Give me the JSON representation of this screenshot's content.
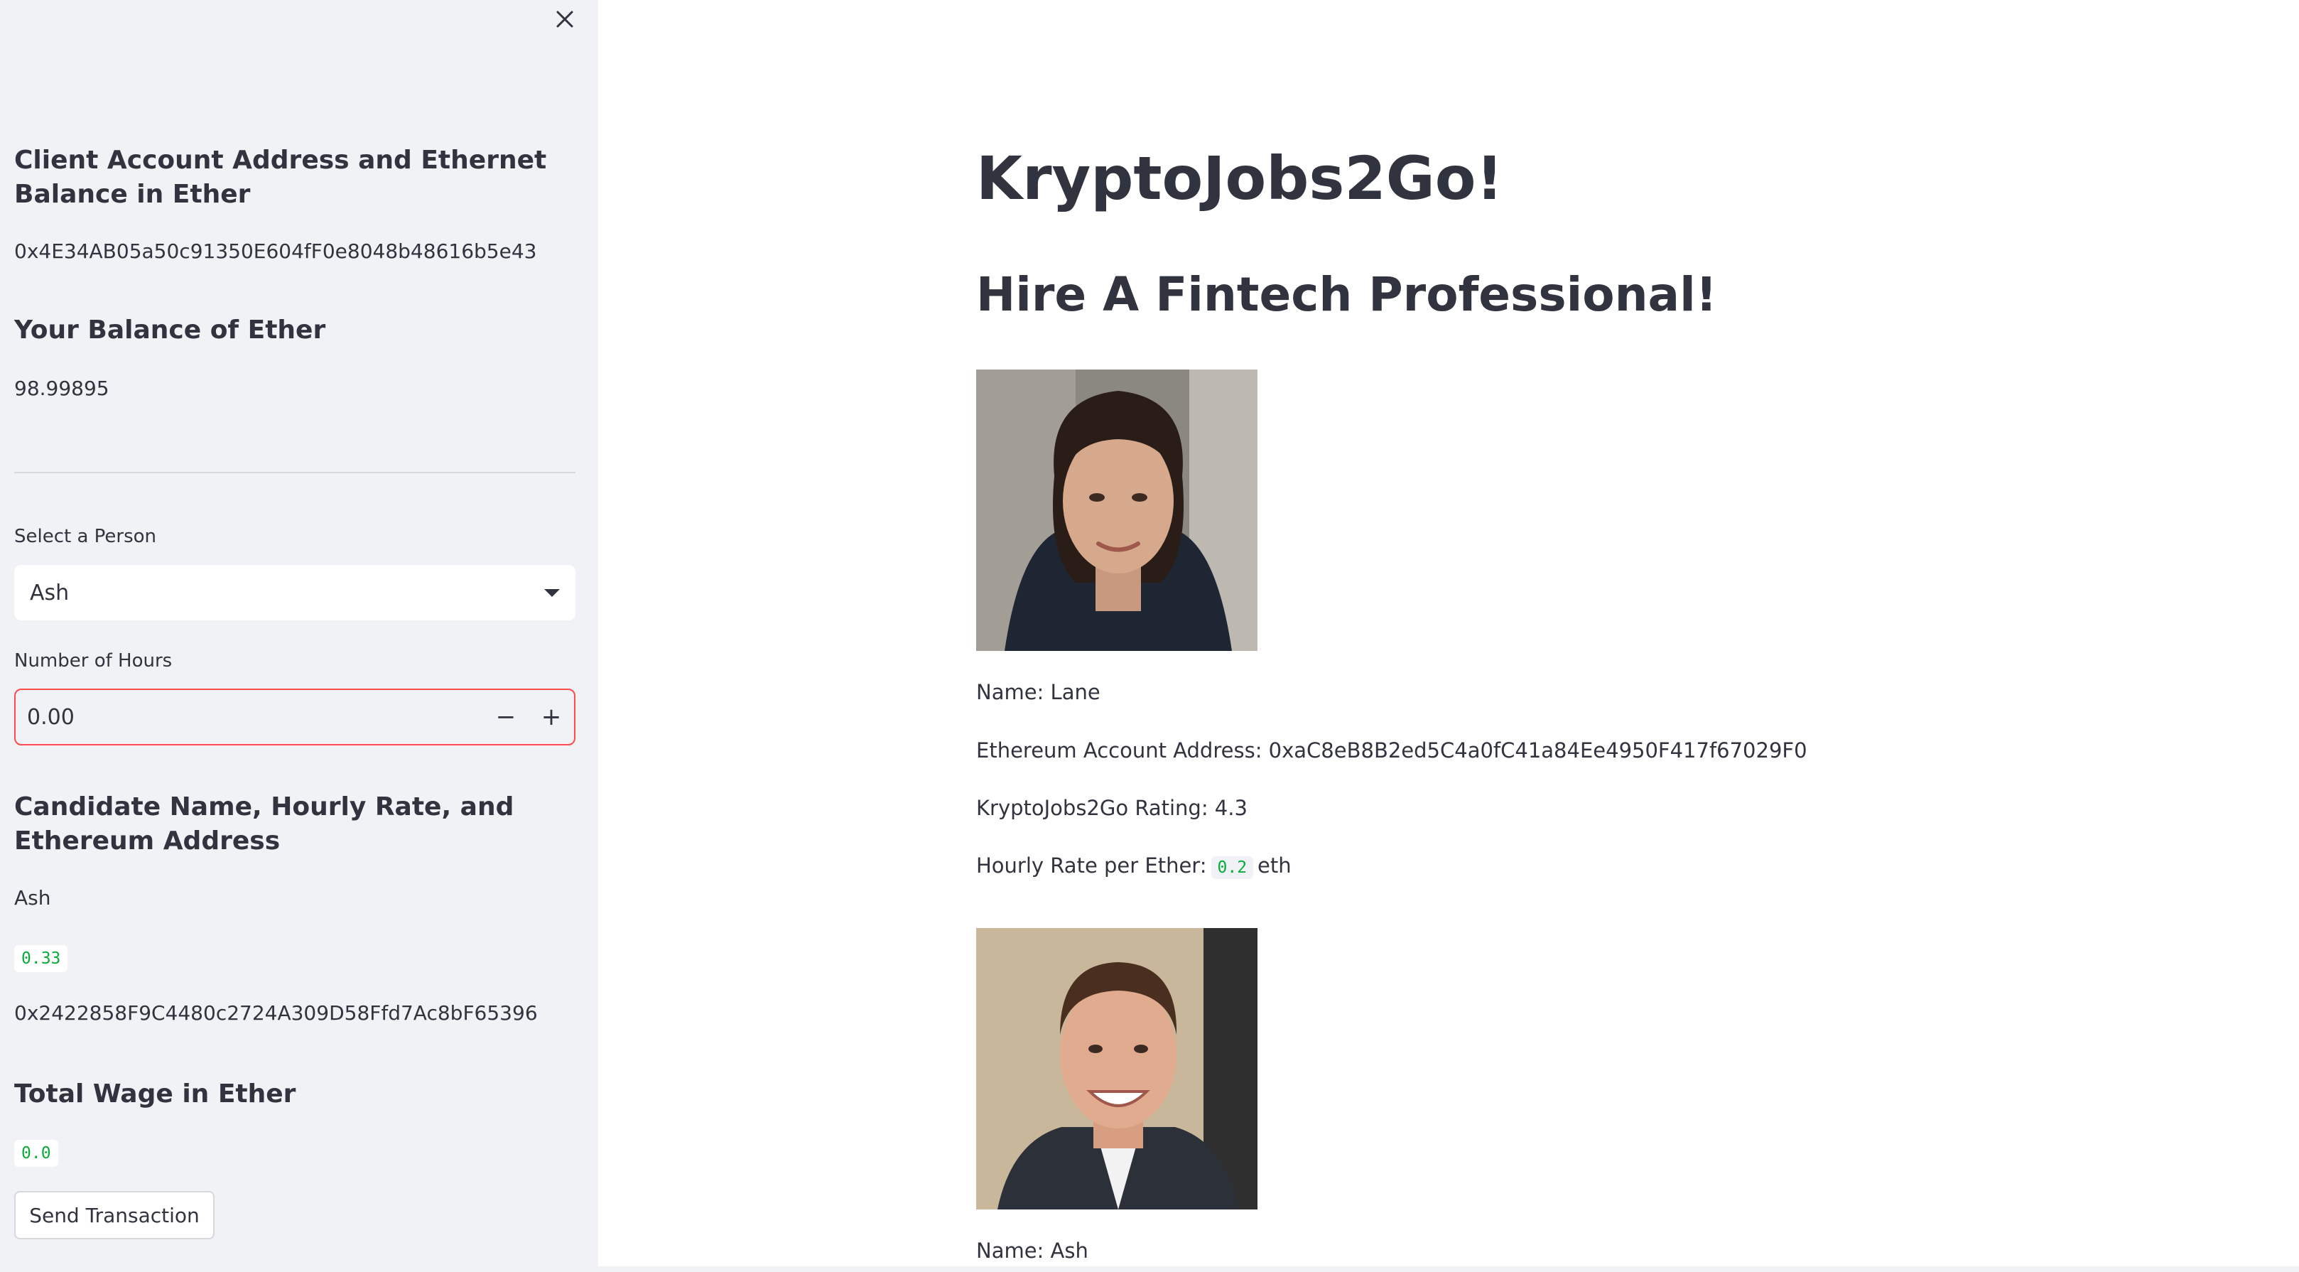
{
  "sidebar": {
    "account_heading": "Client Account Address and Ethernet Balance in Ether",
    "account_address": "0x4E34AB05a50c91350E604fF0e8048b48616b5e43",
    "balance_heading": "Your Balance of Ether",
    "balance_value": "98.99895",
    "select_label": "Select a Person",
    "select_value": "Ash",
    "hours_label": "Number of Hours",
    "hours_value": "0.00",
    "candidate_heading": "Candidate Name, Hourly Rate, and Ethereum Address",
    "candidate_name": "Ash",
    "candidate_rate": "0.33",
    "candidate_address": "0x2422858F9C4480c2724A309D58Ffd7Ac8bF65396",
    "wage_heading": "Total Wage in Ether",
    "wage_value": "0.0",
    "send_button": "Send Transaction"
  },
  "main": {
    "title": "KryptoJobs2Go!",
    "subtitle": "Hire A Fintech Professional!",
    "candidates": [
      {
        "name_line": "Name: Lane",
        "address_line": "Ethereum Account Address: 0xaC8eB8B2ed5C4a0fC41a84Ee4950F417f67029F0",
        "rating_line": "KryptoJobs2Go Rating: 4.3",
        "rate_prefix": "Hourly Rate per Ether:",
        "rate_value": "0.2",
        "rate_suffix": "eth"
      },
      {
        "name_line": "Name: Ash"
      }
    ]
  },
  "colors": {
    "sidebar_bg": "#f0f2f6",
    "text": "#31333f",
    "code_green": "#09ab3b",
    "input_focus_border": "#ff4b4b"
  }
}
